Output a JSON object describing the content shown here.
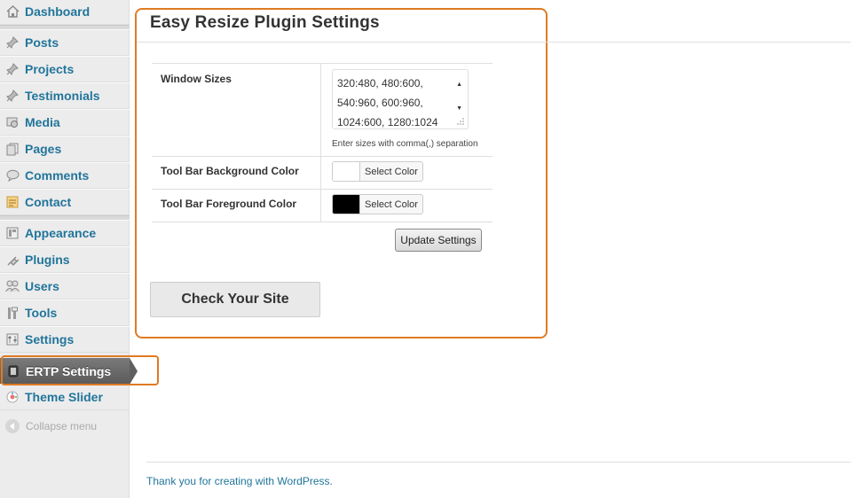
{
  "sidebar": {
    "items": [
      {
        "label": "Dashboard",
        "icon": "dashboard-icon"
      },
      {
        "label": "Posts",
        "icon": "pushpin-icon"
      },
      {
        "label": "Projects",
        "icon": "pushpin-icon"
      },
      {
        "label": "Testimonials",
        "icon": "pushpin-icon"
      },
      {
        "label": "Media",
        "icon": "media-icon"
      },
      {
        "label": "Pages",
        "icon": "pages-icon"
      },
      {
        "label": "Comments",
        "icon": "comment-icon"
      },
      {
        "label": "Contact",
        "icon": "contact-icon"
      },
      {
        "label": "Appearance",
        "icon": "appearance-icon"
      },
      {
        "label": "Plugins",
        "icon": "plug-icon"
      },
      {
        "label": "Users",
        "icon": "users-icon"
      },
      {
        "label": "Tools",
        "icon": "tools-icon"
      },
      {
        "label": "Settings",
        "icon": "settings-icon"
      }
    ],
    "active": {
      "label": "ERTP Settings",
      "icon": "device-icon"
    },
    "after_active": {
      "label": "Theme Slider",
      "icon": "slider-icon"
    },
    "collapse_label": "Collapse menu"
  },
  "main": {
    "title": "Easy Resize Plugin Settings",
    "window_sizes": {
      "label": "Window Sizes",
      "value": "320:480, 480:600,\n540:960, 600:960,\n1024:600, 1280:1024",
      "help": "Enter sizes with comma(,) separation"
    },
    "toolbar_bg": {
      "label": "Tool Bar Background Color",
      "button": "Select Color",
      "color": "#ffffff"
    },
    "toolbar_fg": {
      "label": "Tool Bar Foreground Color",
      "button": "Select Color",
      "color": "#000000"
    },
    "update_button": "Update Settings",
    "check_button": "Check Your Site"
  },
  "footer": {
    "text": "Thank you for creating with WordPress."
  },
  "colors": {
    "accent_orange": "#e07a23",
    "link_blue": "#21759b"
  }
}
